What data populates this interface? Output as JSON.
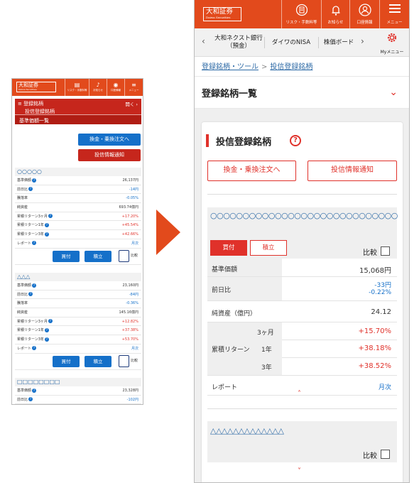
{
  "left_phone": {
    "header": {
      "logo_text": "大和証券",
      "logo_sub": "Daiwa Securities",
      "buttons": [
        {
          "label": "リスク・手数料等",
          "icon": "document-icon"
        },
        {
          "label": "お知らせ",
          "icon": "bell-icon"
        },
        {
          "label": "口座情報",
          "icon": "person-icon"
        },
        {
          "label": "メニュー",
          "icon": "hamburger-icon"
        }
      ]
    },
    "red_menu": {
      "line1": "登録銘柄",
      "line2": "投信登録銘柄",
      "line3": "基準価額一覧",
      "open_label": "開く"
    },
    "buttons": {
      "exchange": "換金・乗換注文へ",
      "notify": "投信情報通知"
    },
    "funds": [
      {
        "name": "○○○○○",
        "rows": [
          {
            "label": "基準価額",
            "value": "26,137円",
            "help": true,
            "color": "#333333"
          },
          {
            "label": "前日比",
            "value": "-14円",
            "help": true,
            "color": "#1570c9"
          },
          {
            "label": "騰落率",
            "value": "-0.05%",
            "help": false,
            "color": "#1570c9"
          },
          {
            "label": "純資産",
            "value": "693.74億円",
            "help": false,
            "color": "#333333"
          },
          {
            "label": "累積リターン3ヶ月",
            "value": "+17.20%",
            "help": true,
            "color": "#e0312a"
          },
          {
            "label": "累積リターン1年",
            "value": "+45.54%",
            "help": true,
            "color": "#e0312a"
          },
          {
            "label": "累積リターン3年",
            "value": "+42.66%",
            "help": true,
            "color": "#e0312a"
          },
          {
            "label": "レポート",
            "value": "月次",
            "help": true,
            "color": "#1570c9"
          }
        ],
        "buy": "買付",
        "reserve": "積立",
        "compare": "比較"
      },
      {
        "name": "△△△",
        "rows": [
          {
            "label": "基準価額",
            "value": "23,160円",
            "help": true,
            "color": "#333333"
          },
          {
            "label": "前日比",
            "value": "-84円",
            "help": true,
            "color": "#1570c9"
          },
          {
            "label": "騰落率",
            "value": "-0.36%",
            "help": false,
            "color": "#1570c9"
          },
          {
            "label": "純資産",
            "value": "145.16億円",
            "help": false,
            "color": "#333333"
          },
          {
            "label": "累積リターン3ヶ月",
            "value": "+12.82%",
            "help": true,
            "color": "#e0312a"
          },
          {
            "label": "累積リターン1年",
            "value": "+37.38%",
            "help": true,
            "color": "#e0312a"
          },
          {
            "label": "累積リターン3年",
            "value": "+53.70%",
            "help": true,
            "color": "#e0312a"
          },
          {
            "label": "レポート",
            "value": "月次",
            "help": true,
            "color": "#1570c9"
          }
        ],
        "buy": "買付",
        "reserve": "積立",
        "compare": "比較"
      },
      {
        "name": "□□□□□□□□",
        "rows": [
          {
            "label": "基準価額",
            "value": "23,328円",
            "help": true,
            "color": "#333333"
          },
          {
            "label": "前日比",
            "value": "-102円",
            "help": true,
            "color": "#1570c9"
          }
        ]
      }
    ]
  },
  "right_phone": {
    "header": {
      "logo_text": "大和証券",
      "logo_sub": "Daiwa Securities",
      "buttons": [
        {
          "label": "リスク・手数料等",
          "icon": "document-icon"
        },
        {
          "label": "お知らせ",
          "icon": "bell-icon"
        },
        {
          "label": "口座情報",
          "icon": "person-icon"
        },
        {
          "label": "メニュー",
          "icon": "hamburger-icon"
        }
      ]
    },
    "nav": {
      "prev": "‹",
      "next": "›",
      "items": [
        "大和ネクスト銀行（預金）",
        "ダイワのNISA",
        "株価ボード"
      ],
      "my_menu": "Myメニュー"
    },
    "breadcrumb": {
      "item1": "登録銘柄・ツール",
      "sep": ">",
      "item2": "投信登録銘柄"
    },
    "page_title": "登録銘柄一覧",
    "section_title": "投信登録銘柄",
    "buttons": {
      "exchange": "換金・乗換注文へ",
      "notify": "投信情報通知"
    },
    "fund1": {
      "name": "○○○○○○○○○○○○○○○○○○○○○○○○○○○○○",
      "tab_buy": "買付",
      "tab_reserve": "積立",
      "compare": "比較",
      "nav_label": "基準価額",
      "nav_value": "15,068円",
      "change_label": "前日比",
      "change_yen": "-33円",
      "change_pct": "-0.22%",
      "assets_label": "純資産（億円）",
      "assets_value": "24.12",
      "return_label": "累積リターン",
      "returns": [
        {
          "period": "3ヶ月",
          "value": "+15.70%"
        },
        {
          "period": "1年",
          "value": "+38.18%"
        },
        {
          "period": "3年",
          "value": "+38.52%"
        }
      ],
      "report_label": "レポート",
      "report_value": "月次"
    },
    "fund2": {
      "name": "△△△△△△△△△△△△△",
      "compare": "比較"
    }
  }
}
